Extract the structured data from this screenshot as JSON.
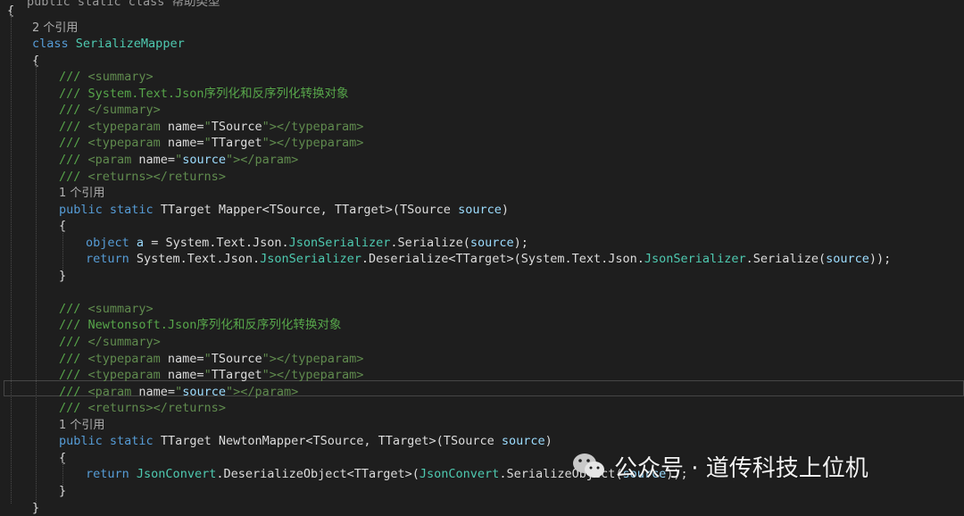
{
  "editor": {
    "top_partial": "public  static  class  帮助类型",
    "lines": [
      {
        "indent": 0,
        "tokens": [
          {
            "t": "{",
            "c": "id"
          }
        ]
      },
      {
        "indent": 1,
        "tokens": [
          {
            "t": "2 个引用",
            "c": "ref"
          }
        ]
      },
      {
        "indent": 1,
        "tokens": [
          {
            "t": "class",
            "c": "kw"
          },
          {
            "t": " ",
            "c": "id"
          },
          {
            "t": "SerializeMapper",
            "c": "cls"
          }
        ]
      },
      {
        "indent": 1,
        "tokens": [
          {
            "t": "{",
            "c": "id"
          }
        ]
      },
      {
        "indent": 2,
        "tokens": [
          {
            "t": "/// ",
            "c": "cmt"
          },
          {
            "t": "<summary>",
            "c": "xml"
          }
        ]
      },
      {
        "indent": 2,
        "tokens": [
          {
            "t": "/// System.Text.Json序列化和反序列化转换对象",
            "c": "cmt"
          }
        ]
      },
      {
        "indent": 2,
        "tokens": [
          {
            "t": "/// ",
            "c": "cmt"
          },
          {
            "t": "</summary>",
            "c": "xml"
          }
        ]
      },
      {
        "indent": 2,
        "tokens": [
          {
            "t": "/// ",
            "c": "cmt"
          },
          {
            "t": "<typeparam ",
            "c": "xml"
          },
          {
            "t": "name=",
            "c": "id"
          },
          {
            "t": "\"",
            "c": "xml"
          },
          {
            "t": "TSource",
            "c": "id"
          },
          {
            "t": "\"",
            "c": "xml"
          },
          {
            "t": "></typeparam>",
            "c": "xml"
          }
        ]
      },
      {
        "indent": 2,
        "tokens": [
          {
            "t": "/// ",
            "c": "cmt"
          },
          {
            "t": "<typeparam ",
            "c": "xml"
          },
          {
            "t": "name=",
            "c": "id"
          },
          {
            "t": "\"",
            "c": "xml"
          },
          {
            "t": "TTarget",
            "c": "id"
          },
          {
            "t": "\"",
            "c": "xml"
          },
          {
            "t": "></typeparam>",
            "c": "xml"
          }
        ]
      },
      {
        "indent": 2,
        "tokens": [
          {
            "t": "/// ",
            "c": "cmt"
          },
          {
            "t": "<param ",
            "c": "xml"
          },
          {
            "t": "name=",
            "c": "id"
          },
          {
            "t": "\"",
            "c": "xml"
          },
          {
            "t": "source",
            "c": "prm"
          },
          {
            "t": "\"",
            "c": "xml"
          },
          {
            "t": "></param>",
            "c": "xml"
          }
        ]
      },
      {
        "indent": 2,
        "tokens": [
          {
            "t": "/// ",
            "c": "cmt"
          },
          {
            "t": "<returns></returns>",
            "c": "xml"
          }
        ]
      },
      {
        "indent": 2,
        "tokens": [
          {
            "t": "1 个引用",
            "c": "ref"
          }
        ]
      },
      {
        "indent": 2,
        "tokens": [
          {
            "t": "public",
            "c": "kw"
          },
          {
            "t": " ",
            "c": "id"
          },
          {
            "t": "static",
            "c": "kw"
          },
          {
            "t": " TTarget Mapper<TSource, TTarget>(TSource ",
            "c": "id"
          },
          {
            "t": "source",
            "c": "prm"
          },
          {
            "t": ")",
            "c": "id"
          }
        ]
      },
      {
        "indent": 2,
        "tokens": [
          {
            "t": "{",
            "c": "id"
          }
        ]
      },
      {
        "indent": 3,
        "tokens": [
          {
            "t": "object",
            "c": "kw"
          },
          {
            "t": " ",
            "c": "id"
          },
          {
            "t": "a",
            "c": "prm"
          },
          {
            "t": " = System.Text.Json.",
            "c": "id"
          },
          {
            "t": "JsonSerializer",
            "c": "cls"
          },
          {
            "t": ".Serialize(",
            "c": "id"
          },
          {
            "t": "source",
            "c": "prm"
          },
          {
            "t": ");",
            "c": "id"
          }
        ]
      },
      {
        "indent": 3,
        "tokens": [
          {
            "t": "return",
            "c": "kw"
          },
          {
            "t": " System.Text.Json.",
            "c": "id"
          },
          {
            "t": "JsonSerializer",
            "c": "cls"
          },
          {
            "t": ".Deserialize<TTarget>(System.Text.Json.",
            "c": "id"
          },
          {
            "t": "JsonSerializer",
            "c": "cls"
          },
          {
            "t": ".Serialize(",
            "c": "id"
          },
          {
            "t": "source",
            "c": "prm"
          },
          {
            "t": "));",
            "c": "id"
          }
        ]
      },
      {
        "indent": 2,
        "tokens": [
          {
            "t": "}",
            "c": "id"
          }
        ]
      },
      {
        "indent": 0,
        "tokens": []
      },
      {
        "indent": 2,
        "tokens": [
          {
            "t": "/// ",
            "c": "cmt"
          },
          {
            "t": "<summary>",
            "c": "xml"
          }
        ]
      },
      {
        "indent": 2,
        "tokens": [
          {
            "t": "/// Newtonsoft.Json序列化和反序列化转换对象",
            "c": "cmt"
          }
        ]
      },
      {
        "indent": 2,
        "tokens": [
          {
            "t": "/// ",
            "c": "cmt"
          },
          {
            "t": "</summary>",
            "c": "xml"
          }
        ]
      },
      {
        "indent": 2,
        "tokens": [
          {
            "t": "/// ",
            "c": "cmt"
          },
          {
            "t": "<typeparam ",
            "c": "xml"
          },
          {
            "t": "name=",
            "c": "id"
          },
          {
            "t": "\"",
            "c": "xml"
          },
          {
            "t": "TSource",
            "c": "id"
          },
          {
            "t": "\"",
            "c": "xml"
          },
          {
            "t": "></typeparam>",
            "c": "xml"
          }
        ]
      },
      {
        "indent": 2,
        "tokens": [
          {
            "t": "/// ",
            "c": "cmt"
          },
          {
            "t": "<typeparam ",
            "c": "xml"
          },
          {
            "t": "name=",
            "c": "id"
          },
          {
            "t": "\"",
            "c": "xml"
          },
          {
            "t": "TTarget",
            "c": "id"
          },
          {
            "t": "\"",
            "c": "xml"
          },
          {
            "t": "></typeparam>",
            "c": "xml"
          }
        ]
      },
      {
        "indent": 2,
        "tokens": [
          {
            "t": "/// ",
            "c": "cmt"
          },
          {
            "t": "<param ",
            "c": "xml"
          },
          {
            "t": "name=",
            "c": "id"
          },
          {
            "t": "\"",
            "c": "xml"
          },
          {
            "t": "source",
            "c": "prm"
          },
          {
            "t": "\"",
            "c": "xml"
          },
          {
            "t": "></param>",
            "c": "xml"
          }
        ]
      },
      {
        "indent": 2,
        "tokens": [
          {
            "t": "/// ",
            "c": "cmt"
          },
          {
            "t": "<returns></returns>",
            "c": "xml"
          }
        ]
      },
      {
        "indent": 2,
        "tokens": [
          {
            "t": "1 个引用",
            "c": "ref"
          }
        ]
      },
      {
        "indent": 2,
        "tokens": [
          {
            "t": "public",
            "c": "kw"
          },
          {
            "t": " ",
            "c": "id"
          },
          {
            "t": "static",
            "c": "kw"
          },
          {
            "t": " TTarget NewtonMapper<TSource, TTarget>(TSource ",
            "c": "id"
          },
          {
            "t": "source",
            "c": "prm"
          },
          {
            "t": ")",
            "c": "id"
          }
        ]
      },
      {
        "indent": 2,
        "tokens": [
          {
            "t": "{",
            "c": "id"
          }
        ]
      },
      {
        "indent": 3,
        "tokens": [
          {
            "t": "return",
            "c": "kw"
          },
          {
            "t": " ",
            "c": "id"
          },
          {
            "t": "JsonConvert",
            "c": "cls"
          },
          {
            "t": ".DeserializeObject<TTarget>(",
            "c": "id"
          },
          {
            "t": "JsonConvert",
            "c": "cls"
          },
          {
            "t": ".SerializeObject(",
            "c": "id"
          },
          {
            "t": "source",
            "c": "prm"
          },
          {
            "t": "));",
            "c": "id"
          }
        ]
      },
      {
        "indent": 2,
        "tokens": [
          {
            "t": "}",
            "c": "id"
          }
        ]
      },
      {
        "indent": 1,
        "tokens": [
          {
            "t": "}",
            "c": "id"
          }
        ]
      }
    ]
  },
  "watermark": {
    "icon": "wechat-icon",
    "text": "公众号 · 道传科技上位机"
  }
}
